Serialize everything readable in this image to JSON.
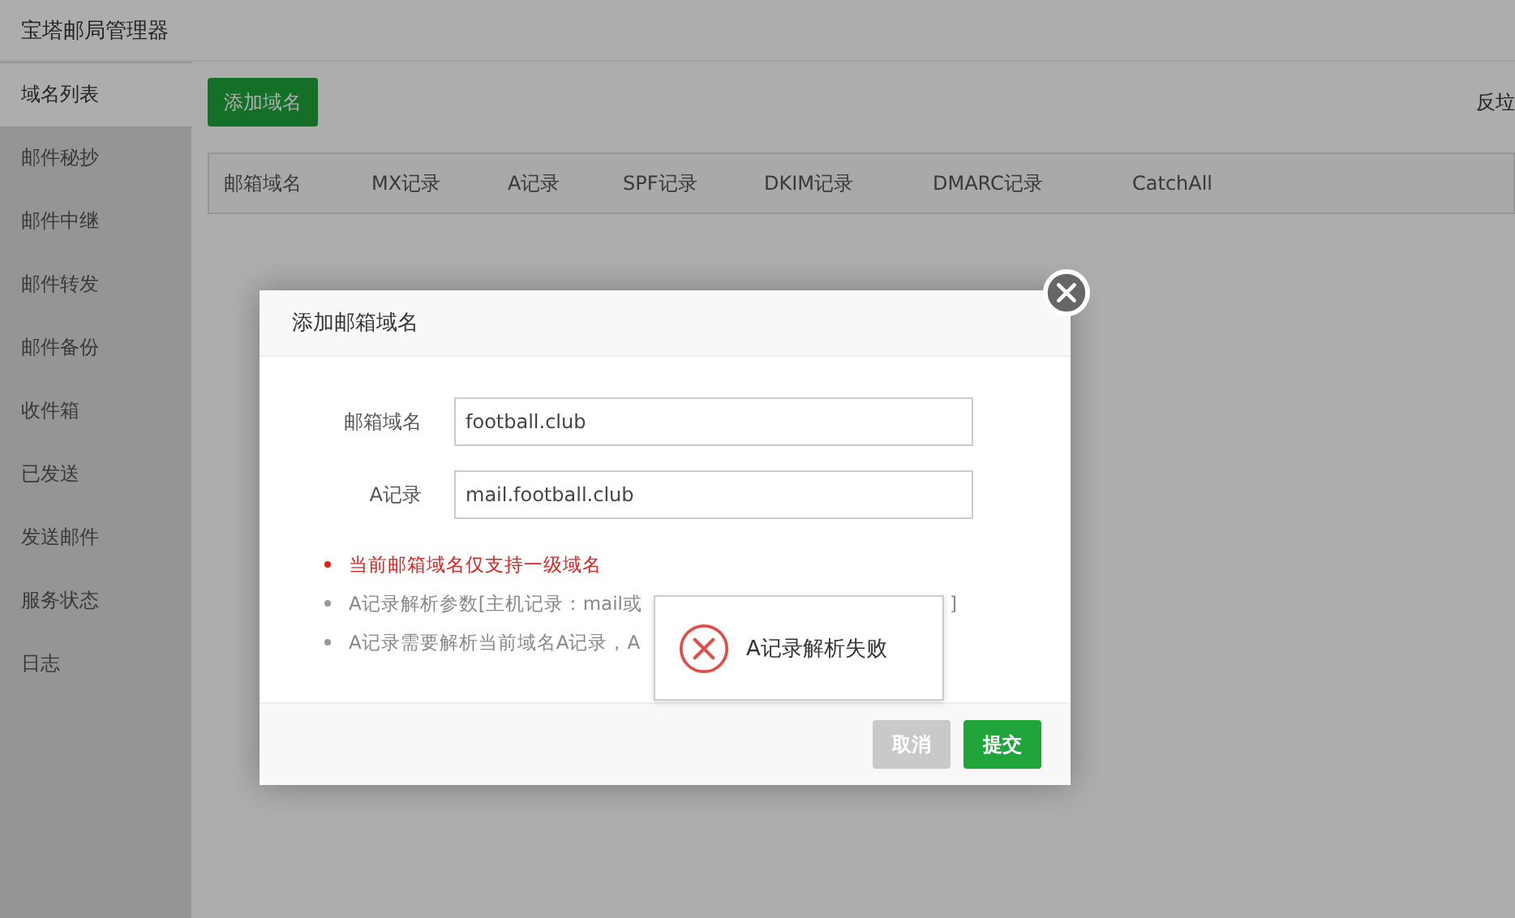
{
  "app_title": "宝塔邮局管理器",
  "sidebar": {
    "items": [
      {
        "label": "域名列表",
        "selected": true
      },
      {
        "label": "邮件秘抄",
        "selected": false
      },
      {
        "label": "邮件中继",
        "selected": false
      },
      {
        "label": "邮件转发",
        "selected": false
      },
      {
        "label": "邮件备份",
        "selected": false
      },
      {
        "label": "收件箱",
        "selected": false
      },
      {
        "label": "已发送",
        "selected": false
      },
      {
        "label": "发送邮件",
        "selected": false
      },
      {
        "label": "服务状态",
        "selected": false
      },
      {
        "label": "日志",
        "selected": false
      }
    ]
  },
  "toolbar": {
    "add_button": "添加域名",
    "right_link": "反垃"
  },
  "table": {
    "columns": [
      "邮箱域名",
      "MX记录",
      "A记录",
      "SPF记录",
      "DKIM记录",
      "DMARC记录",
      "CatchAll"
    ]
  },
  "dialog": {
    "title": "添加邮箱域名",
    "fields": [
      {
        "label": "邮箱域名",
        "value": "football.club"
      },
      {
        "label": "A记录",
        "value": "mail.football.club"
      }
    ],
    "hints": [
      {
        "kind": "error",
        "text": "当前邮箱域名仅支持一级域名"
      },
      {
        "kind": "info",
        "text": "A记录解析参数[主机记录：mail或",
        "tail": "]"
      },
      {
        "kind": "info",
        "text": "A记录需要解析当前域名A记录，A"
      }
    ],
    "buttons": [
      {
        "label": "取消",
        "kind": "secondary"
      },
      {
        "label": "提交",
        "kind": "primary"
      }
    ]
  },
  "toast": {
    "kind": "error",
    "message": "A记录解析失败"
  }
}
